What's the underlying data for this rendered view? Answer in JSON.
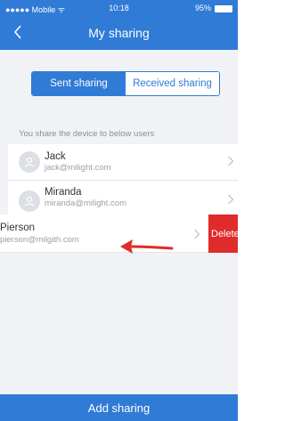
{
  "status_bar": {
    "carrier": "●●●●● Mobile ᯤ",
    "time": "10:18",
    "battery": "95%"
  },
  "header": {
    "title": "My sharing",
    "back_icon": "chevron-left-icon"
  },
  "tabs": [
    {
      "label": "Sent sharing",
      "active": true
    },
    {
      "label": "Received sharing",
      "active": false
    }
  ],
  "section_label": "You share the device to below users",
  "users": [
    {
      "name": "Jack",
      "email": "jack@milight.com"
    },
    {
      "name": "Miranda",
      "email": "miranda@milight.com"
    },
    {
      "name": "Pierson",
      "email": "pierson@milgith.com"
    }
  ],
  "delete_label": "Delete",
  "add_button": "Add sharing",
  "colors": {
    "primary": "#2f7bd6",
    "danger": "#e02b2b",
    "background": "#f0f2f5"
  }
}
